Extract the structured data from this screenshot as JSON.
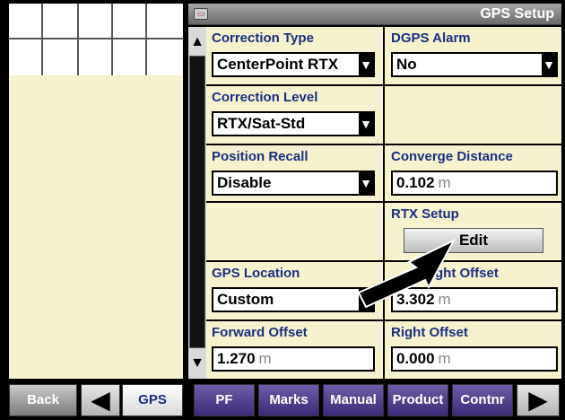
{
  "window": {
    "title": "GPS Setup",
    "icon": "display-icon"
  },
  "scroll": {
    "up": "▲",
    "down": "▼"
  },
  "fields": {
    "correction_type": {
      "label": "Correction Type",
      "value": "CenterPoint RTX"
    },
    "dgps_alarm": {
      "label": "DGPS Alarm",
      "value": "No"
    },
    "correction_level": {
      "label": "Correction Level",
      "value": "RTX/Sat-Std"
    },
    "position_recall": {
      "label": "Position Recall",
      "value": "Disable"
    },
    "converge_distance": {
      "label": "Converge Distance",
      "value": "0.102",
      "unit": "m"
    },
    "rtx_setup": {
      "label": "RTX Setup",
      "button": "Edit"
    },
    "gps_location": {
      "label": "GPS Location",
      "value": "Custom"
    },
    "height_offset": {
      "label": "…ght Offset",
      "value": "3.302",
      "unit": "m"
    },
    "forward_offset": {
      "label": "Forward Offset",
      "value": "1.270",
      "unit": "m"
    },
    "right_offset": {
      "label": "Right Offset",
      "value": "0.000",
      "unit": "m"
    }
  },
  "dropdown_glyph": "▼",
  "bottom_bar": {
    "back": "Back",
    "prev": "◀",
    "gps": "GPS",
    "pf": "PF",
    "marks": "Marks",
    "manual": "Manual",
    "product": "Product",
    "contnr": "Contnr",
    "next": "▶"
  }
}
